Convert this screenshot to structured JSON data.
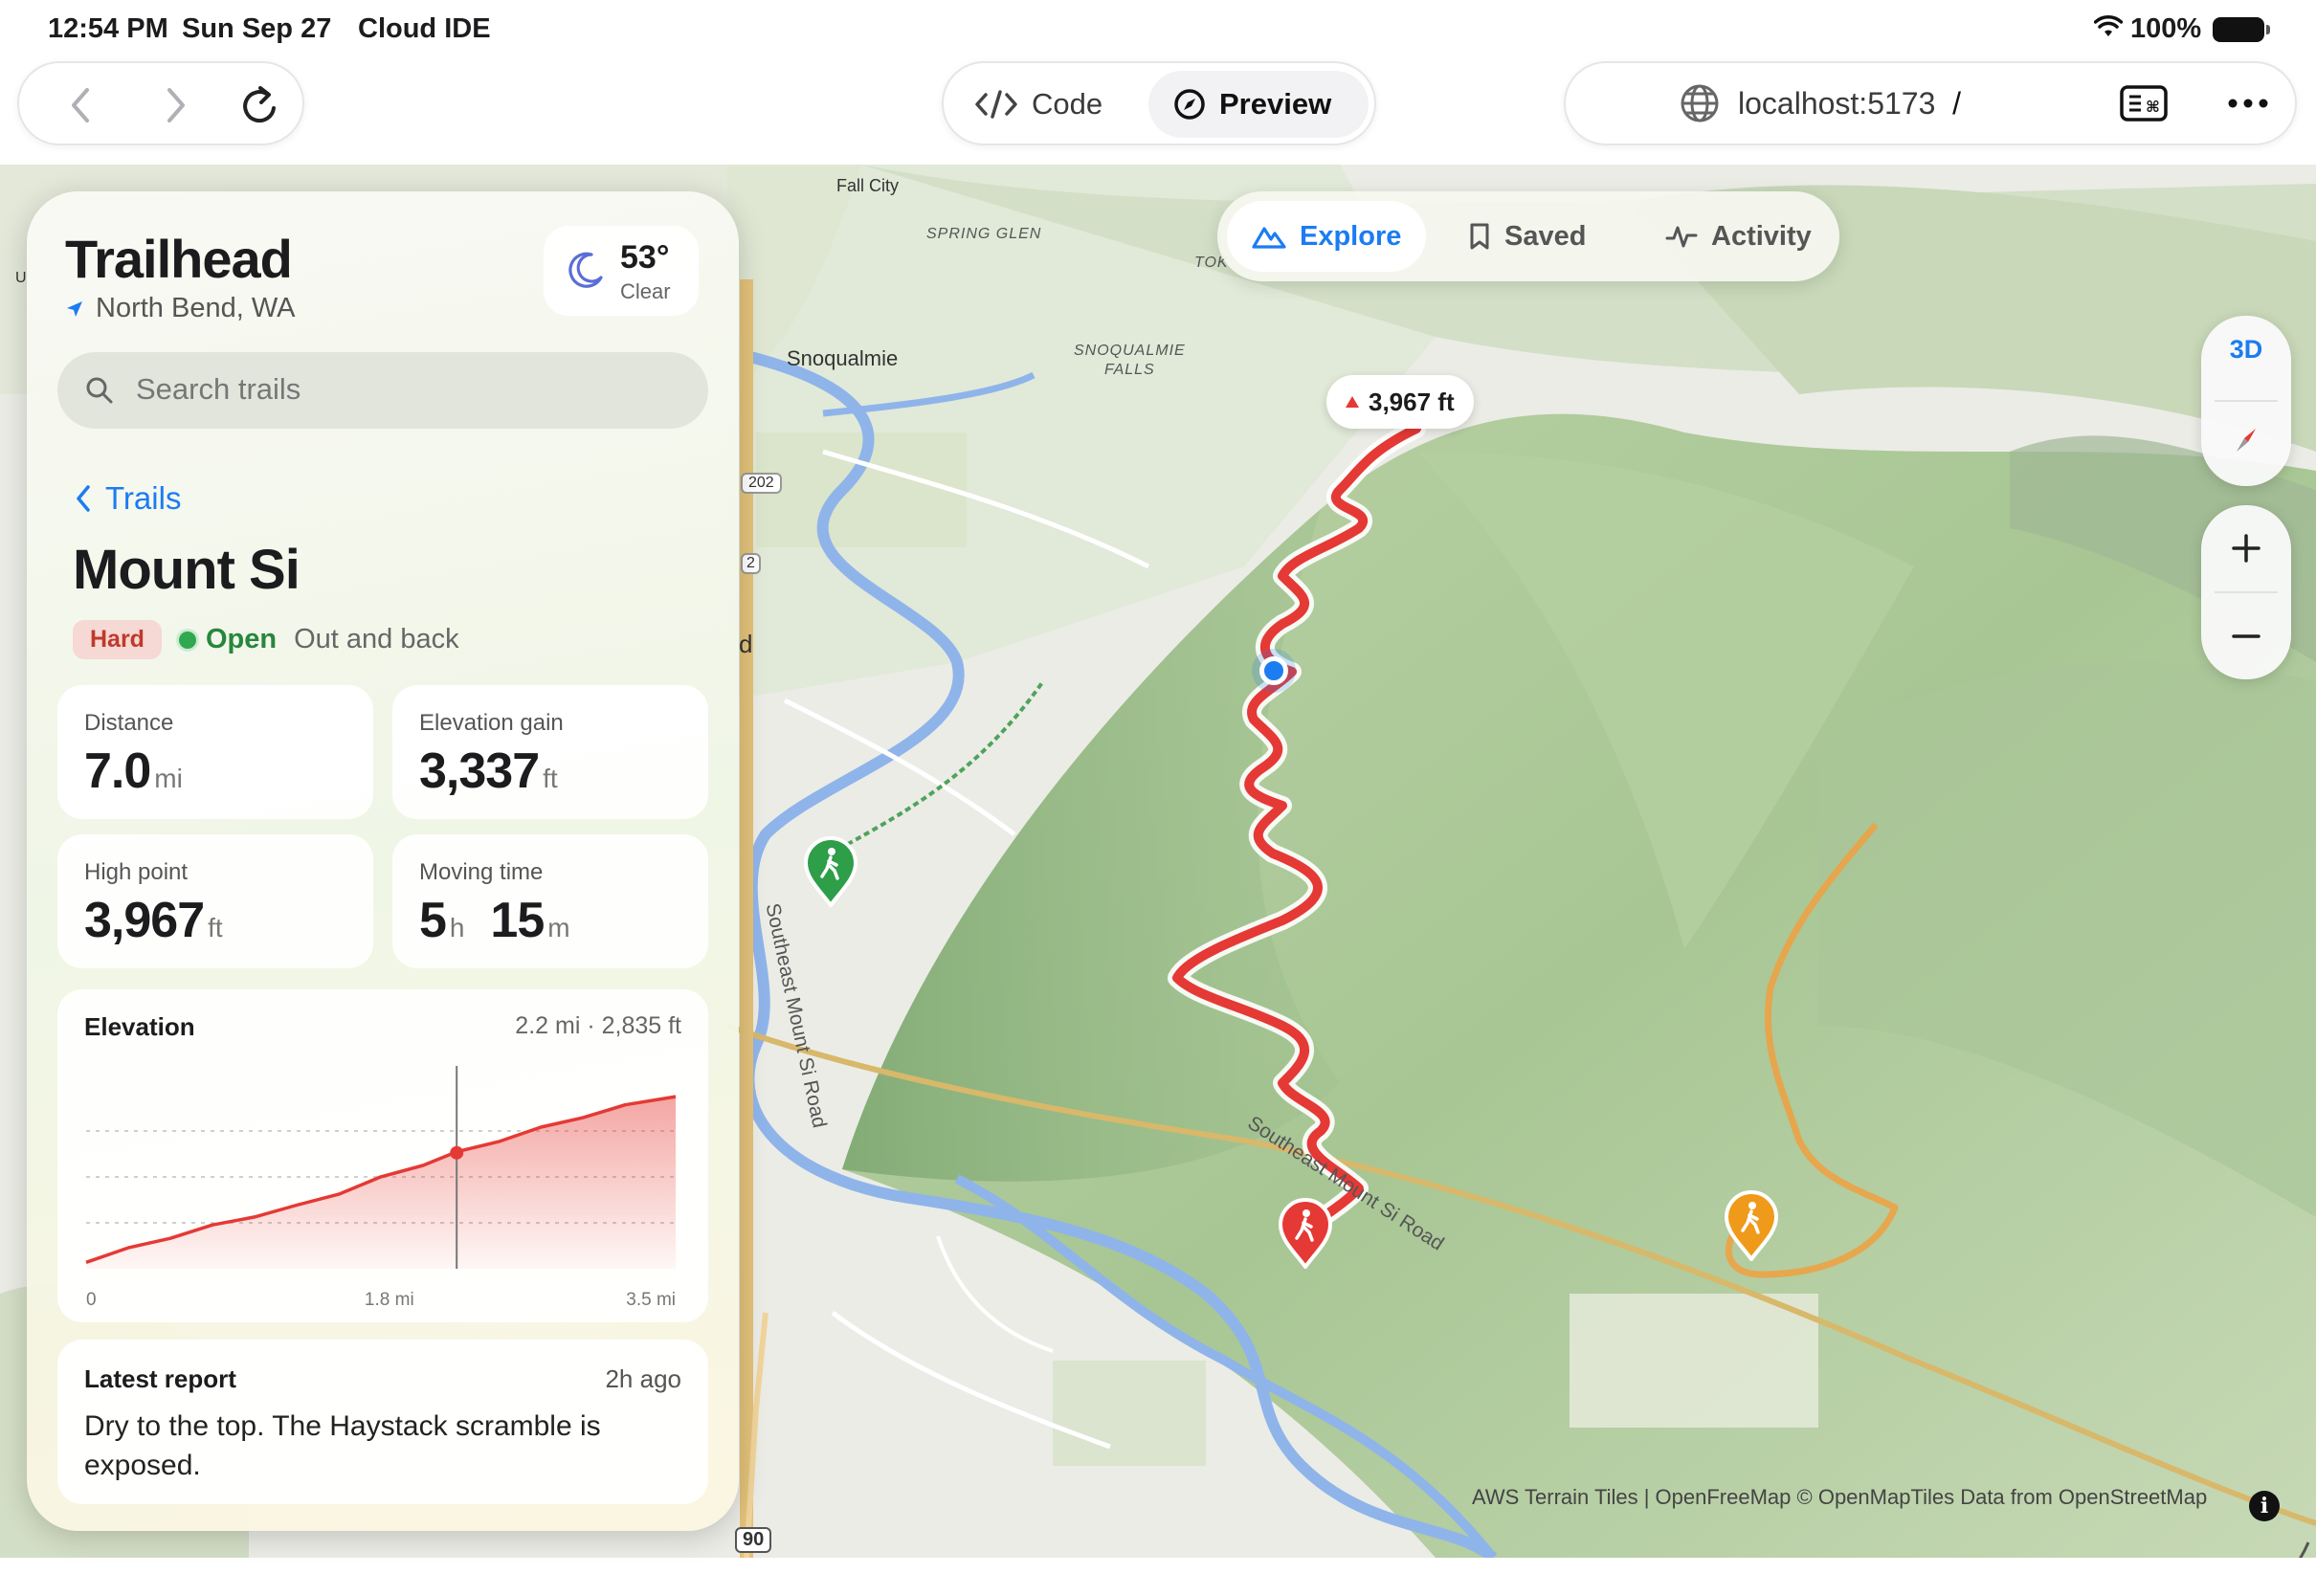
{
  "status": {
    "time": "12:54 PM",
    "date": "Sun Sep 27",
    "app": "Cloud IDE",
    "battery": "100%"
  },
  "toolbar": {
    "modes": {
      "code": "Code",
      "preview": "Preview"
    },
    "url": "localhost:5173",
    "url_path": "/"
  },
  "map": {
    "labels": {
      "fall_city": "Fall City",
      "spring_glen": "SPRING GLEN",
      "tok": "TOK",
      "snoqualmie": "Snoqualmie",
      "snoqualmie_falls_1": "SNOQUALMIE",
      "snoqualmie_falls_2": "FALLS",
      "hwy_202": "202",
      "hwy_2": "2",
      "hwy_90": "90",
      "road_1": "Southeast Mount Si Road",
      "road_2": "Southeast Mount Si Road",
      "edge_d": "d",
      "edge_u": "U"
    },
    "tabs": {
      "explore": "Explore",
      "saved": "Saved",
      "activity": "Activity"
    },
    "controls": {
      "view_3d": "3D"
    },
    "peak_badge": "3,967 ft",
    "attribution": "AWS Terrain Tiles | OpenFreeMap © OpenMapTiles Data from OpenStreetMap",
    "colors": {
      "active_trail": "#e53935",
      "alt_trail": "#f0a040",
      "trailhead_green": "#2e9e49",
      "accent": "#1c7cf2"
    }
  },
  "panel": {
    "app_title": "Trailhead",
    "location": "North Bend, WA",
    "weather": {
      "temp": "53°",
      "condition": "Clear",
      "icon": "moon-icon"
    },
    "search": {
      "placeholder": "Search trails"
    },
    "back_label": "Trails",
    "trail": {
      "name": "Mount Si",
      "difficulty": "Hard",
      "status": "Open",
      "route_type": "Out and back"
    },
    "stats": [
      {
        "label": "Distance",
        "value": "7.0",
        "unit": "mi"
      },
      {
        "label": "Elevation gain",
        "value": "3,337",
        "unit": "ft"
      },
      {
        "label": "High point",
        "value": "3,967",
        "unit": "ft"
      },
      {
        "label": "Moving time",
        "value_h": "5",
        "unit_h": "h",
        "value_m": "15",
        "unit_m": "m"
      }
    ],
    "elevation": {
      "title": "Elevation",
      "cursor_readout": "2.2 mi · 2,835 ft",
      "x_ticks": [
        "0",
        "1.8 mi",
        "3.5 mi"
      ]
    },
    "report": {
      "title": "Latest report",
      "time": "2h ago",
      "body": "Dry to the top. The Haystack scramble is exposed."
    }
  },
  "chart_data": {
    "type": "area",
    "title": "Elevation",
    "xlabel": "",
    "ylabel": "",
    "x_unit": "mi",
    "y_unit": "ft",
    "xlim": [
      0,
      3.5
    ],
    "ylim": [
      500,
      4200
    ],
    "x": [
      0,
      0.25,
      0.5,
      0.75,
      1.0,
      1.25,
      1.5,
      1.75,
      2.0,
      2.2,
      2.45,
      2.7,
      2.95,
      3.2,
      3.5
    ],
    "y": [
      630,
      900,
      1130,
      1360,
      1560,
      1760,
      2020,
      2330,
      2600,
      2835,
      3080,
      3330,
      3560,
      3780,
      3967
    ],
    "cursor": {
      "x": 2.2,
      "y": 2835
    },
    "grid": true,
    "color": "#e53935"
  }
}
